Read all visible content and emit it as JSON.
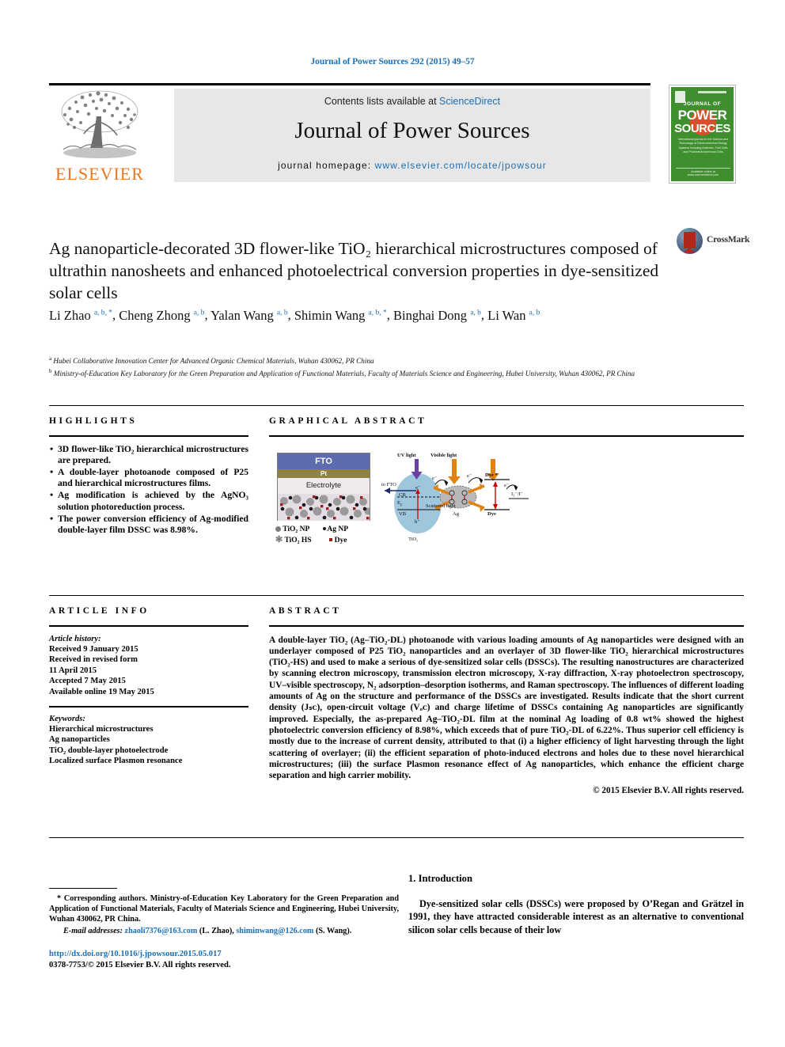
{
  "running_head": "Journal of Power Sources 292 (2015) 49–57",
  "masthead": {
    "contents_prefix": "Contents lists available at ",
    "contents_link": "ScienceDirect",
    "journal_title": "Journal of Power Sources",
    "homepage_label": "journal homepage:",
    "homepage_url": "www.elsevier.com/locate/jpowsour",
    "publisher": "ELSEVIER",
    "cover": {
      "line1": "JOURNAL OF",
      "line2": "POWER",
      "line3": "SOURCES",
      "blurb": "International journal on the Science and Technology of Electrochemical Energy Systems including Batteries, Fuel Cells and Photoelectrochemical Cells",
      "footer": "Available online at www.sciencedirect.com"
    }
  },
  "article": {
    "title": "Ag nanoparticle-decorated 3D flower-like TiO₂ hierarchical microstructures composed of ultrathin nanosheets and enhanced photoelectrical conversion properties in dye-sensitized solar cells",
    "crossmark_label": "CrossMark",
    "authors": [
      {
        "name": "Li Zhao",
        "marks": "a, b, *",
        "sep": ", "
      },
      {
        "name": "Cheng Zhong",
        "marks": "a, b",
        "sep": ", "
      },
      {
        "name": "Yalan Wang",
        "marks": "a, b",
        "sep": ", "
      },
      {
        "name": "Shimin Wang",
        "marks": "a, b, *",
        "sep": ", "
      },
      {
        "name": "Binghai Dong",
        "marks": "a, b",
        "sep": ", "
      },
      {
        "name": "Li Wan",
        "marks": "a, b",
        "sep": ""
      }
    ],
    "affiliations": [
      {
        "mark": "a",
        "text": "Hubei Collaborative Innovation Center for Advanced Organic Chemical Materials, Wuhan 430062, PR China"
      },
      {
        "mark": "b",
        "text": "Ministry-of-Education Key Laboratory for the Green Preparation and Application of Functional Materials, Faculty of Materials Science and Engineering, Hubei University, Wuhan 430062, PR China"
      }
    ]
  },
  "highlights": {
    "label": "HIGHLIGHTS",
    "items": [
      "3D flower-like TiO₂ hierarchical microstructures are prepared.",
      "A double-layer photoanode composed of P25 and hierarchical microstructures films.",
      "Ag modification is achieved by the AgNO₃ solution photoreduction process.",
      "The power conversion efficiency of Ag-modified double-layer film DSSC was 8.98%."
    ]
  },
  "graphical_abstract": {
    "label": "GRAPHICAL ABSTRACT",
    "schematic": {
      "fto": "FTO",
      "pt": "Pt",
      "electrolyte": "Electrolyte",
      "legend": [
        {
          "icon": "grey-circle",
          "text": "TiO₂ NP"
        },
        {
          "icon": "black-dot",
          "text": "Ag NP"
        },
        {
          "icon": "star",
          "text": "TiO₂ HS"
        },
        {
          "icon": "red-square",
          "text": "Dye"
        }
      ]
    },
    "energy_diagram": {
      "uv_light": "UV light",
      "visible_light": "Visible light",
      "to_fto": "to FTO",
      "cb": "CB",
      "ef": "E",
      "ef_sub": "F",
      "vb": "VB",
      "electron": "e⁻",
      "hole": "h⁺",
      "scattered_light": "Scattered light",
      "ag": "Ag",
      "dye": "Dye",
      "dye_star": "Dye *",
      "redox": "I₃⁻/I⁻",
      "tio2": "TiO₂"
    }
  },
  "article_info": {
    "label": "ARTICLE INFO",
    "history_heading": "Article history:",
    "history": [
      "Received 9 January 2015",
      "Received in revised form",
      "11 April 2015",
      "Accepted 7 May 2015",
      "Available online 19 May 2015"
    ],
    "keywords_heading": "Keywords:",
    "keywords": [
      "Hierarchical microstructures",
      "Ag nanoparticles",
      "TiO₂ double-layer photoelectrode",
      "Localized surface Plasmon resonance"
    ]
  },
  "abstract": {
    "label": "ABSTRACT",
    "text": "A double-layer TiO₂ (Ag–TiO₂-DL) photoanode with various loading amounts of Ag nanoparticles were designed with an underlayer composed of P25 TiO₂ nanoparticles and an overlayer of 3D flower-like TiO₂ hierarchical microstructures (TiO₂-HS) and used to make a serious of dye-sensitized solar cells (DSSCs). The resulting nanostructures are characterized by scanning electron microscopy, transmission electron microscopy, X-ray diffraction, X-ray photoelectron spectroscopy, UV–visible spectroscopy, N₂ adsorption–desorption isotherms, and Raman spectroscopy. The influences of different loading amounts of Ag on the structure and performance of the DSSCs are investigated. Results indicate that the short current density (Jₛᴄ), open-circuit voltage (Vₒᴄ) and charge lifetime of DSSCs containing Ag nanoparticles are significantly improved. Especially, the as-prepared Ag–TiO₂-DL film at the nominal Ag loading of 0.8 wt% showed the highest photoelectric conversion efficiency of 8.98%, which exceeds that of pure TiO₂-DL of 6.22%. Thus superior cell efficiency is mostly due to the increase of current density, attributed to that (i) a higher efficiency of light harvesting through the light scattering of overlayer; (ii) the efficient separation of photo-induced electrons and holes due to these novel hierarchical microstructures; (iii) the surface Plasmon resonance effect of Ag nanoparticles, which enhance the efficient charge separation and high carrier mobility.",
    "copyright": "© 2015 Elsevier B.V. All rights reserved."
  },
  "footnote": {
    "corresponding": "* Corresponding authors. Ministry-of-Education Key Laboratory for the Green Preparation and Application of Functional Materials, Faculty of Materials Science and Engineering, Hubei University, Wuhan 430062, PR China.",
    "email_label": "E-mail addresses:",
    "email1": "zhaoli7376@163.com",
    "email1_owner": "(L. Zhao),",
    "email2": "shiminwang@126.com",
    "email2_owner": "(S. Wang).",
    "doi": "http://dx.doi.org/10.1016/j.jpowsour.2015.05.017",
    "issn": "0378-7753/© 2015 Elsevier B.V. All rights reserved."
  },
  "introduction": {
    "heading": "1. Introduction",
    "paragraph": "Dye-sensitized solar cells (DSSCs) were proposed by O’Regan and Grätzel in 1991, they have attracted considerable interest as an alternative to conventional silicon solar cells because of their low"
  }
}
